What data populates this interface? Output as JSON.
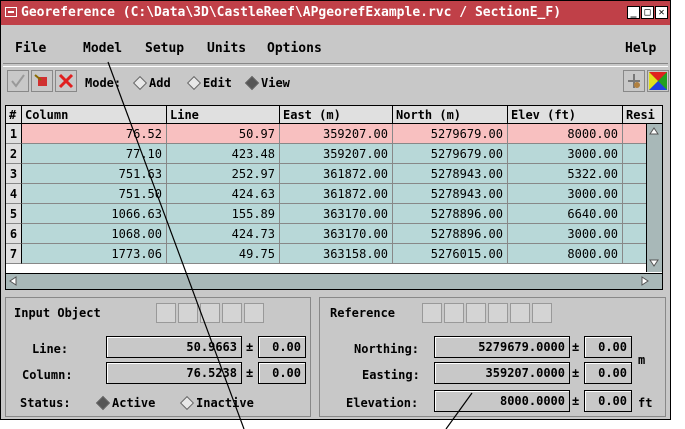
{
  "window": {
    "title": "Georeference (C:\\Data\\3D\\CastleReef\\APgeorefExample.rvc / SectionE_F)",
    "controls": [
      "_",
      "□",
      "✕"
    ]
  },
  "menu": {
    "items": [
      "File",
      "Model",
      "Setup",
      "Units",
      "Options"
    ],
    "help": "Help"
  },
  "toolbar": {
    "mode_label": "Mode:",
    "modes": [
      "Add",
      "Edit",
      "View"
    ],
    "selected_mode": "View"
  },
  "table": {
    "headers": [
      "#",
      "Column",
      "Line",
      "East (m)",
      "North (m)",
      "Elev (ft)",
      "Resi"
    ],
    "rows": [
      [
        "1",
        "76.52",
        "50.97",
        "359207.00",
        "5279679.00",
        "8000.00"
      ],
      [
        "2",
        "77.10",
        "423.48",
        "359207.00",
        "5279679.00",
        "3000.00"
      ],
      [
        "3",
        "751.63",
        "252.97",
        "361872.00",
        "5278943.00",
        "5322.00"
      ],
      [
        "4",
        "751.50",
        "424.63",
        "361872.00",
        "5278943.00",
        "3000.00"
      ],
      [
        "5",
        "1066.63",
        "155.89",
        "363170.00",
        "5278896.00",
        "6640.00"
      ],
      [
        "6",
        "1068.00",
        "424.73",
        "363170.00",
        "5278896.00",
        "3000.00"
      ],
      [
        "7",
        "1773.06",
        "49.75",
        "363158.00",
        "5276015.00",
        "8000.00"
      ]
    ],
    "selected_row": 1,
    "colors": {
      "selected": "#f8c0c0",
      "normal": "#b8d8d8"
    }
  },
  "input_object": {
    "title": "Input Object",
    "line_label": "Line:",
    "line_value": "50.9663",
    "line_err": "0.00",
    "column_label": "Column:",
    "column_value": "76.5238",
    "column_err": "0.00",
    "status_label": "Status:",
    "status_options": [
      "Active",
      "Inactive"
    ],
    "status_selected": "Active"
  },
  "reference": {
    "title": "Reference",
    "northing_label": "Northing:",
    "northing_value": "5279679.0000",
    "northing_err": "0.00",
    "easting_label": "Easting:",
    "easting_value": "359207.0000",
    "easting_err": "0.00",
    "unit_m": "m",
    "elevation_label": "Elevation:",
    "elevation_value": "8000.0000",
    "elevation_err": "0.00",
    "unit_ft": "ft"
  },
  "pm_symbol": "±"
}
